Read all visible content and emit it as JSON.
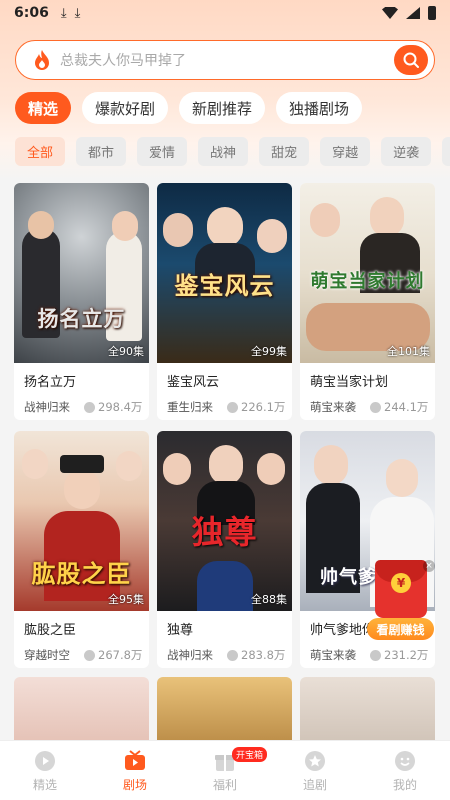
{
  "status_bar": {
    "time": "6:06"
  },
  "search": {
    "placeholder": "总裁夫人你马甲掉了"
  },
  "main_tabs": [
    "精选",
    "爆款好剧",
    "新剧推荐",
    "独播剧场"
  ],
  "categories": [
    "全部",
    "都市",
    "爱情",
    "战神",
    "甜宠",
    "穿越",
    "逆袭",
    "霸"
  ],
  "dramas": [
    {
      "title": "扬名立万",
      "poster_text": "扬名立万",
      "episodes": "全90集",
      "genre": "战神归来",
      "views": "298.4万"
    },
    {
      "title": "鉴宝风云",
      "poster_text": "鉴宝风云",
      "episodes": "全99集",
      "genre": "重生归来",
      "views": "226.1万"
    },
    {
      "title": "萌宝当家计划",
      "poster_text": "萌宝当家计划",
      "episodes": "全101集",
      "genre": "萌宝来袭",
      "views": "244.1万"
    },
    {
      "title": "肱股之臣",
      "poster_text": "肱股之臣",
      "episodes": "全95集",
      "genre": "穿越时空",
      "views": "267.8万"
    },
    {
      "title": "独尊",
      "poster_text": "独尊",
      "episodes": "全88集",
      "genre": "战神归来",
      "views": "283.8万"
    },
    {
      "title": "帅气爹地你",
      "poster_text": "帅气爹地你",
      "episodes": "",
      "genre": "萌宝来袭",
      "views": "231.2万"
    }
  ],
  "floating_reward": {
    "label": "看剧赚钱",
    "coin": "¥"
  },
  "bottom_nav": {
    "items": [
      "精选",
      "剧场",
      "福利",
      "追剧",
      "我的"
    ],
    "badge": "开宝箱"
  },
  "colors": {
    "accent": "#ff5a1e",
    "nav_inactive": "#b3b3b3"
  }
}
